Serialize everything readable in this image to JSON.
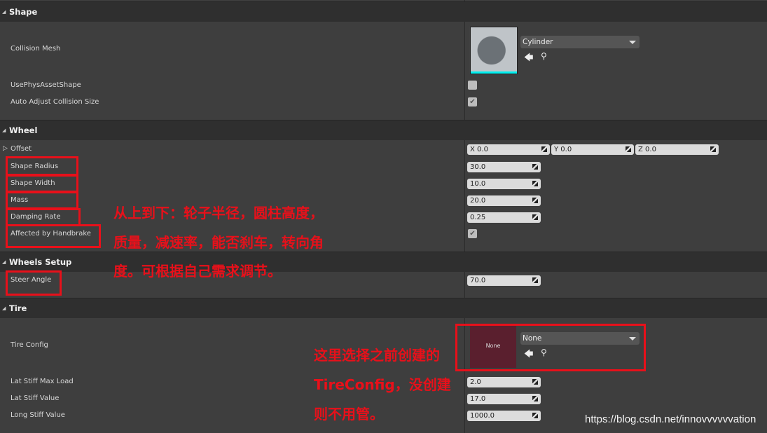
{
  "sections": {
    "shape": "Shape",
    "wheel": "Wheel",
    "wheels_setup": "Wheels Setup",
    "tire": "Tire"
  },
  "labels": {
    "collision_mesh": "Collision Mesh",
    "use_phys": "UsePhysAssetShape",
    "auto_adjust": "Auto Adjust Collision Size",
    "offset": "Offset",
    "shape_radius": "Shape Radius",
    "shape_width": "Shape Width",
    "mass": "Mass",
    "damping_rate": "Damping Rate",
    "affected_by_handbrake": "Affected by Handbrake",
    "steer_angle": "Steer Angle",
    "tire_config": "Tire Config",
    "lat_stiff_max_load": "Lat Stiff Max Load",
    "lat_stiff_value": "Lat Stiff Value",
    "long_stiff_value": "Long Stiff Value"
  },
  "values": {
    "collision_mesh": "Cylinder",
    "use_phys": false,
    "auto_adjust": true,
    "offset_x": "X  0.0",
    "offset_y": "Y  0.0",
    "offset_z": "Z  0.0",
    "shape_radius": "30.0",
    "shape_width": "10.0",
    "mass": "20.0",
    "damping_rate": "0.25",
    "affected_by_handbrake": true,
    "steer_angle": "70.0",
    "tire_config": "None",
    "tire_thumb": "None",
    "lat_stiff_max_load": "2.0",
    "lat_stiff_value": "17.0",
    "long_stiff_value": "1000.0"
  },
  "annotations": {
    "a1_l1": "从上到下：轮子半径，圆柱高度，",
    "a1_l2": "质量，减速率，能否刹车，转向角",
    "a1_l3": "度。可根据自己需求调节。",
    "a2_l1": "这里选择之前创建的",
    "a2_l2": "TireConfig，没创建",
    "a2_l3": "则不用管。"
  },
  "watermark": "https://blog.csdn.net/innovvvvvvation",
  "colors": {
    "annotation": "#e8101a",
    "thumb_bar": "#00f0f0",
    "tire_thumb": "#5a1f2e"
  }
}
